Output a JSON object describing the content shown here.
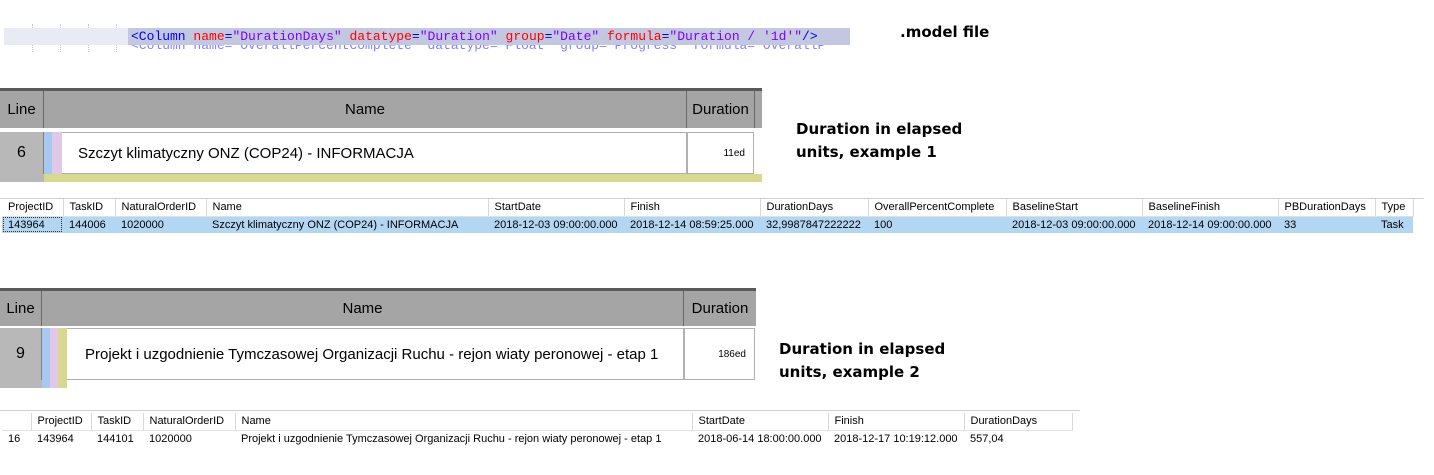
{
  "model_file": {
    "caption": ".model file",
    "xml": {
      "open": "<Column",
      "attrs": [
        {
          "name": "name",
          "value": "\"DurationDays\""
        },
        {
          "name": "datatype",
          "value": "\"Duration\""
        },
        {
          "name": "group",
          "value": "\"Date\""
        },
        {
          "name": "formula",
          "value": "\"Duration / '1d'\""
        }
      ],
      "close": "/>",
      "next_line_partial": "<Column name=\"OverallPercentComplete\" datatype=\"Float\" group=\"Progress\" formula=\"OverallP"
    }
  },
  "example1": {
    "caption_line1": "Duration in elapsed",
    "caption_line2": "units, example 1",
    "grid": {
      "headers": {
        "line": "Line",
        "name": "Name",
        "duration": "Duration"
      },
      "row": {
        "line": "6",
        "name": "Szczyt klimatyczny ONZ (COP24) - INFORMACJA",
        "duration": "11ed"
      }
    },
    "table": {
      "columns": [
        "ProjectID",
        "TaskID",
        "NaturalOrderID",
        "Name",
        "StartDate",
        "Finish",
        "DurationDays",
        "OverallPercentComplete",
        "BaselineStart",
        "BaselineFinish",
        "PBDurationDays",
        "Type"
      ],
      "row": [
        "143964",
        "144006",
        "1020000",
        "Szczyt klimatyczny ONZ (COP24) - INFORMACJA",
        "2018-12-03 09:00:00.000",
        "2018-12-14 08:59:25.000",
        "32,9987847222222",
        "100",
        "2018-12-03 09:00:00.000",
        "2018-12-14 09:00:00.000",
        "33",
        "Task"
      ]
    }
  },
  "example2": {
    "caption_line1": "Duration in elapsed",
    "caption_line2": "units, example 2",
    "grid": {
      "headers": {
        "line": "Line",
        "name": "Name",
        "duration": "Duration"
      },
      "row": {
        "line": "9",
        "name": "Projekt i uzgodnienie Tymczasowej Organizacji Ruchu - rejon wiaty peronowej - etap 1",
        "duration": "186ed"
      }
    },
    "table": {
      "columns": [
        "",
        "ProjectID",
        "TaskID",
        "NaturalOrderID",
        "Name",
        "StartDate",
        "Finish",
        "DurationDays"
      ],
      "row": [
        "16",
        "143964",
        "144101",
        "1020000",
        "Projekt i uzgodnienie Tymczasowej Organizacji Ruchu - rejon wiaty peronowej - etap 1",
        "2018-06-14 18:00:00.000",
        "2018-12-17 10:19:12.000",
        "557,04"
      ]
    }
  },
  "colors": {
    "grid_header": "#a5a5a5",
    "selected_row": "#b3d6f3",
    "xml_tag": "#0000ff",
    "xml_attr_name": "#ff0000",
    "xml_attr_value": "#8000ff",
    "stripe_blue": "#a8c8f0",
    "stripe_pink": "#e0c8e8",
    "stripe_yellow": "#d8d890"
  }
}
